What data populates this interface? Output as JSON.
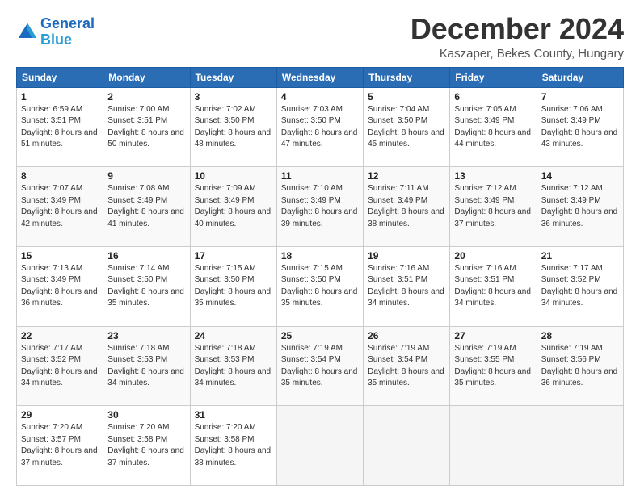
{
  "header": {
    "logo_line1": "General",
    "logo_line2": "Blue",
    "month": "December 2024",
    "location": "Kaszaper, Bekes County, Hungary"
  },
  "days_of_week": [
    "Sunday",
    "Monday",
    "Tuesday",
    "Wednesday",
    "Thursday",
    "Friday",
    "Saturday"
  ],
  "weeks": [
    [
      {
        "day": 1,
        "sunrise": "6:59 AM",
        "sunset": "3:51 PM",
        "daylight": "8 hours and 51 minutes."
      },
      {
        "day": 2,
        "sunrise": "7:00 AM",
        "sunset": "3:51 PM",
        "daylight": "8 hours and 50 minutes."
      },
      {
        "day": 3,
        "sunrise": "7:02 AM",
        "sunset": "3:50 PM",
        "daylight": "8 hours and 48 minutes."
      },
      {
        "day": 4,
        "sunrise": "7:03 AM",
        "sunset": "3:50 PM",
        "daylight": "8 hours and 47 minutes."
      },
      {
        "day": 5,
        "sunrise": "7:04 AM",
        "sunset": "3:50 PM",
        "daylight": "8 hours and 45 minutes."
      },
      {
        "day": 6,
        "sunrise": "7:05 AM",
        "sunset": "3:49 PM",
        "daylight": "8 hours and 44 minutes."
      },
      {
        "day": 7,
        "sunrise": "7:06 AM",
        "sunset": "3:49 PM",
        "daylight": "8 hours and 43 minutes."
      }
    ],
    [
      {
        "day": 8,
        "sunrise": "7:07 AM",
        "sunset": "3:49 PM",
        "daylight": "8 hours and 42 minutes."
      },
      {
        "day": 9,
        "sunrise": "7:08 AM",
        "sunset": "3:49 PM",
        "daylight": "8 hours and 41 minutes."
      },
      {
        "day": 10,
        "sunrise": "7:09 AM",
        "sunset": "3:49 PM",
        "daylight": "8 hours and 40 minutes."
      },
      {
        "day": 11,
        "sunrise": "7:10 AM",
        "sunset": "3:49 PM",
        "daylight": "8 hours and 39 minutes."
      },
      {
        "day": 12,
        "sunrise": "7:11 AM",
        "sunset": "3:49 PM",
        "daylight": "8 hours and 38 minutes."
      },
      {
        "day": 13,
        "sunrise": "7:12 AM",
        "sunset": "3:49 PM",
        "daylight": "8 hours and 37 minutes."
      },
      {
        "day": 14,
        "sunrise": "7:12 AM",
        "sunset": "3:49 PM",
        "daylight": "8 hours and 36 minutes."
      }
    ],
    [
      {
        "day": 15,
        "sunrise": "7:13 AM",
        "sunset": "3:49 PM",
        "daylight": "8 hours and 36 minutes."
      },
      {
        "day": 16,
        "sunrise": "7:14 AM",
        "sunset": "3:50 PM",
        "daylight": "8 hours and 35 minutes."
      },
      {
        "day": 17,
        "sunrise": "7:15 AM",
        "sunset": "3:50 PM",
        "daylight": "8 hours and 35 minutes."
      },
      {
        "day": 18,
        "sunrise": "7:15 AM",
        "sunset": "3:50 PM",
        "daylight": "8 hours and 35 minutes."
      },
      {
        "day": 19,
        "sunrise": "7:16 AM",
        "sunset": "3:51 PM",
        "daylight": "8 hours and 34 minutes."
      },
      {
        "day": 20,
        "sunrise": "7:16 AM",
        "sunset": "3:51 PM",
        "daylight": "8 hours and 34 minutes."
      },
      {
        "day": 21,
        "sunrise": "7:17 AM",
        "sunset": "3:52 PM",
        "daylight": "8 hours and 34 minutes."
      }
    ],
    [
      {
        "day": 22,
        "sunrise": "7:17 AM",
        "sunset": "3:52 PM",
        "daylight": "8 hours and 34 minutes."
      },
      {
        "day": 23,
        "sunrise": "7:18 AM",
        "sunset": "3:53 PM",
        "daylight": "8 hours and 34 minutes."
      },
      {
        "day": 24,
        "sunrise": "7:18 AM",
        "sunset": "3:53 PM",
        "daylight": "8 hours and 34 minutes."
      },
      {
        "day": 25,
        "sunrise": "7:19 AM",
        "sunset": "3:54 PM",
        "daylight": "8 hours and 35 minutes."
      },
      {
        "day": 26,
        "sunrise": "7:19 AM",
        "sunset": "3:54 PM",
        "daylight": "8 hours and 35 minutes."
      },
      {
        "day": 27,
        "sunrise": "7:19 AM",
        "sunset": "3:55 PM",
        "daylight": "8 hours and 35 minutes."
      },
      {
        "day": 28,
        "sunrise": "7:19 AM",
        "sunset": "3:56 PM",
        "daylight": "8 hours and 36 minutes."
      }
    ],
    [
      {
        "day": 29,
        "sunrise": "7:20 AM",
        "sunset": "3:57 PM",
        "daylight": "8 hours and 37 minutes."
      },
      {
        "day": 30,
        "sunrise": "7:20 AM",
        "sunset": "3:58 PM",
        "daylight": "8 hours and 37 minutes."
      },
      {
        "day": 31,
        "sunrise": "7:20 AM",
        "sunset": "3:58 PM",
        "daylight": "8 hours and 38 minutes."
      },
      null,
      null,
      null,
      null
    ]
  ],
  "labels": {
    "sunrise": "Sunrise:",
    "sunset": "Sunset:",
    "daylight": "Daylight:"
  }
}
